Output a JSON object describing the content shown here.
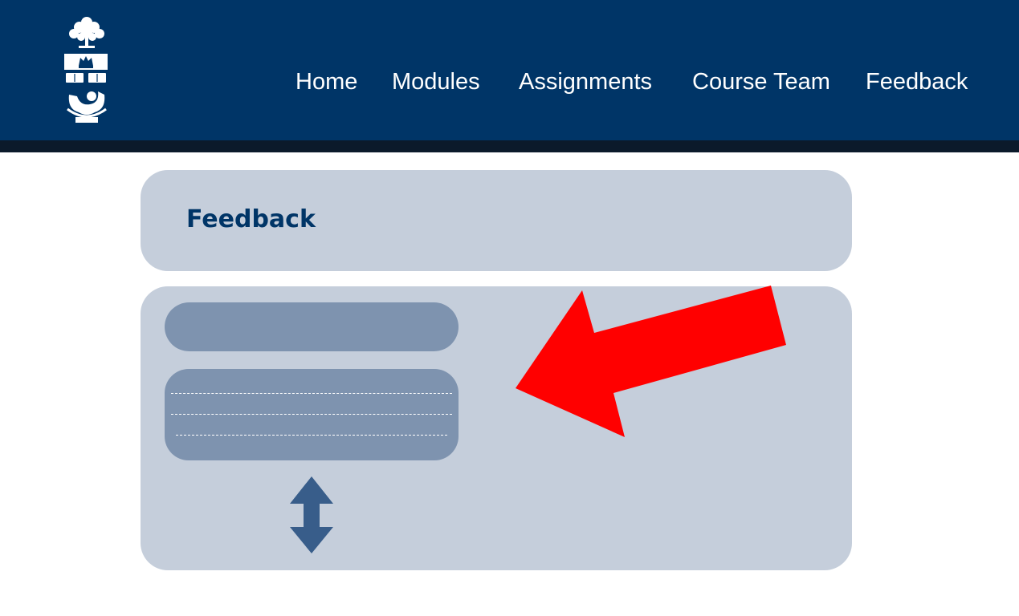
{
  "header": {
    "nav": [
      {
        "key": "home",
        "label": "Home"
      },
      {
        "key": "modules",
        "label": "Modules"
      },
      {
        "key": "assignments",
        "label": "Assignments"
      },
      {
        "key": "course-team",
        "label": "Course Team"
      },
      {
        "key": "feedback",
        "label": "Feedback"
      }
    ],
    "logo_icon": "university-crest-icon"
  },
  "main": {
    "title": "Feedback"
  },
  "colors": {
    "header_bg": "#003567",
    "panel_bg": "#c5cedb",
    "field_bg": "#7e93af",
    "annotation_arrow": "#ff0000",
    "resize_arrow": "#385d8a"
  },
  "icons": {
    "annotation": "red-arrow-icon",
    "resize": "double-vertical-arrow-icon"
  }
}
